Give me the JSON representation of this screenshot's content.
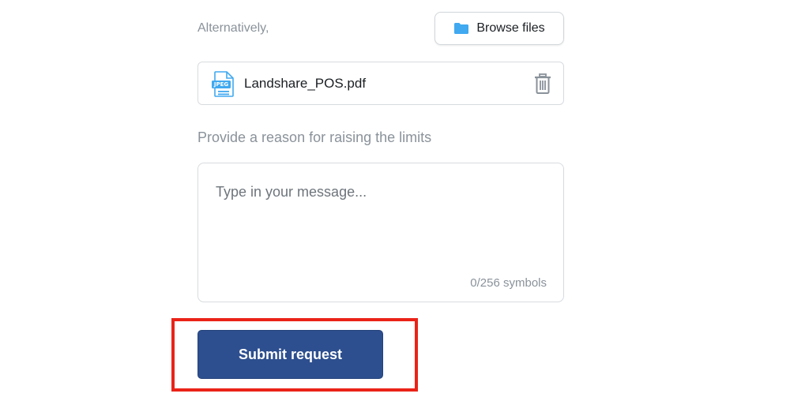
{
  "upload": {
    "alternatively_text": "Alternatively,",
    "browse_button_label": "Browse files",
    "browse_icon": "folder-icon",
    "file": {
      "name": "Landshare_POS.pdf",
      "type_badge": "JPEG",
      "file_icon": "jpeg-file-icon",
      "delete_icon": "trash-icon"
    }
  },
  "reason": {
    "label": "Provide a reason for raising the limits",
    "placeholder": "Type in your message...",
    "counter": "0/256 symbols"
  },
  "submit": {
    "label": "Submit request"
  },
  "colors": {
    "primary_button": "#2d4f8f",
    "folder_icon": "#40a9f0",
    "highlight_border": "#ea2318"
  }
}
